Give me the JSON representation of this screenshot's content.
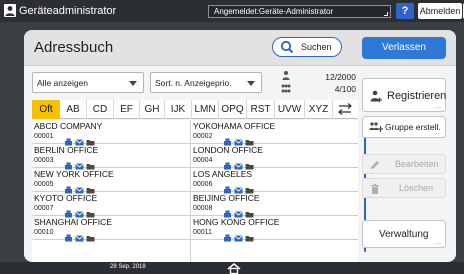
{
  "topbar": {
    "title": "Geräteadministrator",
    "login_status": "Angemeldet:Geräte-Administrator",
    "help_label": "?",
    "logout_label": "Abmelden"
  },
  "panel": {
    "title": "Adressbuch",
    "search_label": "Suchen",
    "exit_label": "Verlassen"
  },
  "filters": {
    "display_selected": "Alle anzeigen",
    "sort_selected": "Sort. n. Anzeigeprio.",
    "count_top": "12/2000",
    "count_bottom": "4/100"
  },
  "tabs": [
    "Oft",
    "AB",
    "CD",
    "EF",
    "GH",
    "IJK",
    "LMN",
    "OPQ",
    "RST",
    "UVW",
    "XYZ"
  ],
  "active_tab": "Oft",
  "entries": [
    {
      "left": {
        "name": "ABCD COMPANY",
        "number": "00001"
      },
      "right": {
        "name": "YOKOHAMA OFFICE",
        "number": "00002"
      }
    },
    {
      "left": {
        "name": "BERLIN OFFICE",
        "number": "00003"
      },
      "right": {
        "name": "LONDON OFFICE",
        "number": "00004"
      }
    },
    {
      "left": {
        "name": "NEW YORK OFFICE",
        "number": "00005"
      },
      "right": {
        "name": "LOS ANGELES",
        "number": "00006"
      }
    },
    {
      "left": {
        "name": "KYOTO OFFICE",
        "number": "00007"
      },
      "right": {
        "name": "BEIJING OFFICE",
        "number": "00008"
      }
    },
    {
      "left": {
        "name": "SHANGHAI OFFICE",
        "number": "00010"
      },
      "right": {
        "name": "HONG KONG OFFICE",
        "number": "00011"
      }
    }
  ],
  "side_buttons": {
    "register": "Registrieren",
    "group": "Gruppe erstell.",
    "edit": "Bearbeiten",
    "delete": "Löschen",
    "manage": "Verwaltung"
  },
  "bottom": {
    "date": "28 Sep. 2018"
  },
  "colors": {
    "accent_blue": "#2e78d8",
    "active_tab": "#f6c200",
    "topbar": "#2b2f33"
  },
  "icons": {
    "user": "user-icon",
    "search": "search-icon",
    "register": "add-user-icon",
    "group": "group-icon",
    "edit": "pencil-icon",
    "delete": "trash-icon",
    "home": "home-icon",
    "entry_types": [
      "fax-icon",
      "email-icon",
      "folder-icon"
    ]
  }
}
